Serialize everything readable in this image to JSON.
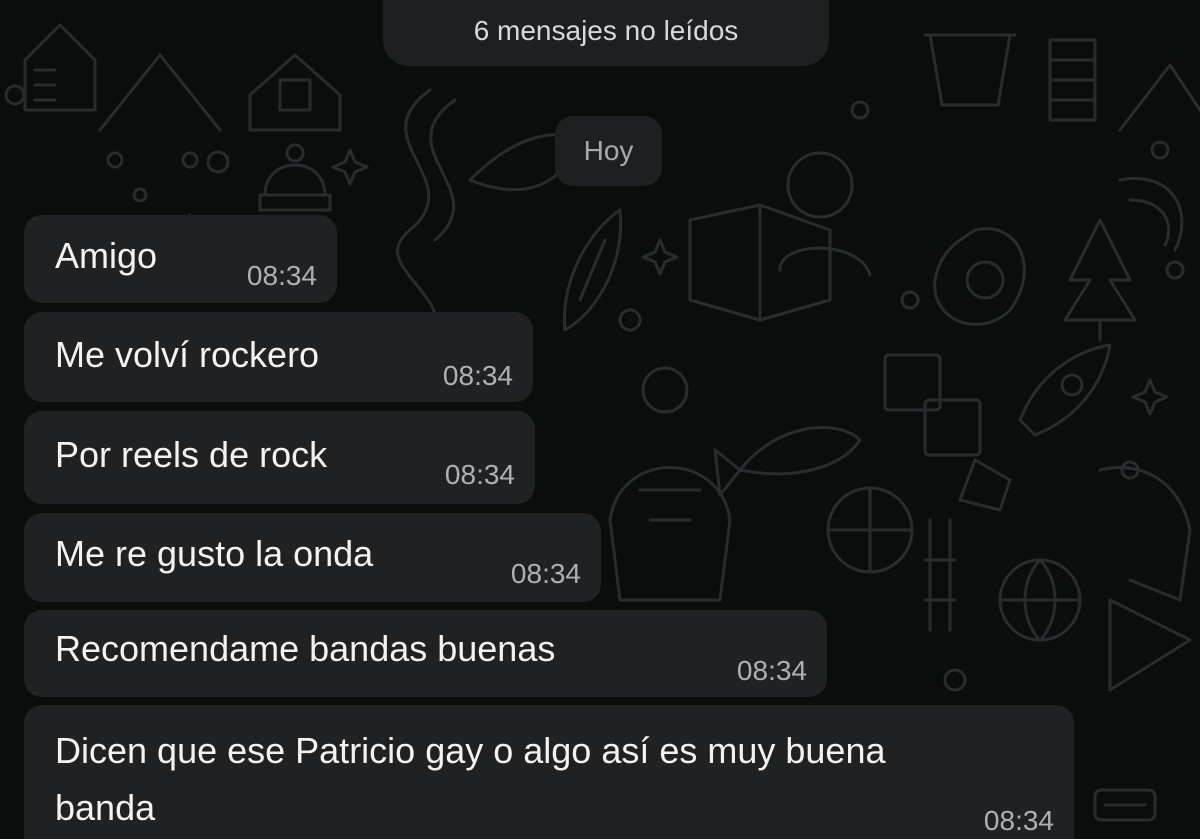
{
  "chat": {
    "unread_banner": "6 mensajes no leídos",
    "date_separator": "Hoy",
    "messages": [
      {
        "text": "Amigo",
        "time": "08:34"
      },
      {
        "text": "Me volví rockero",
        "time": "08:34"
      },
      {
        "text": "Por reels de rock",
        "time": "08:34"
      },
      {
        "text": "Me re gusto la onda",
        "time": "08:34"
      },
      {
        "text": "Recomendame bandas buenas",
        "time": "08:34"
      },
      {
        "text": "Dicen que ese Patricio gay o algo así es muy buena banda",
        "time": "08:34"
      }
    ]
  },
  "colors": {
    "background": "#0b0c0c",
    "bubble": "#1f2123",
    "pill": "#1d1f21",
    "message_text": "#f2f2f2",
    "timestamp": "#aeb1b4",
    "wallpaper_doodle": "#2b2e31"
  }
}
